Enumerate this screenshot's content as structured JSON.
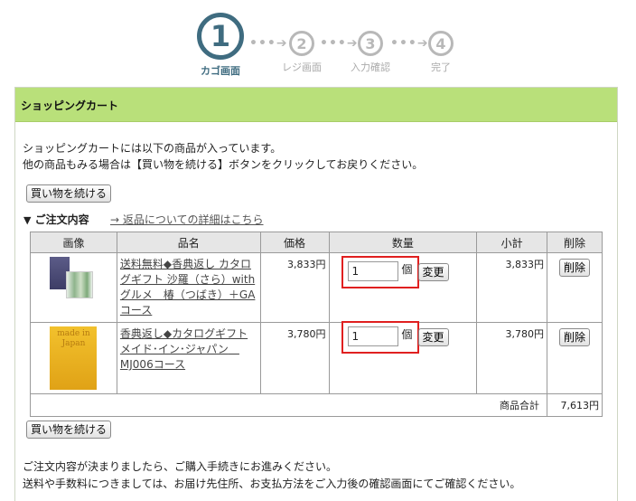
{
  "steps": [
    {
      "num": "1",
      "label": "カゴ画面"
    },
    {
      "num": "2",
      "label": "レジ画面"
    },
    {
      "num": "3",
      "label": "入力確認"
    },
    {
      "num": "4",
      "label": "完了"
    }
  ],
  "step_arrow": "•••➔",
  "panel": {
    "title": "ショッピングカート",
    "intro_line1": "ショッピングカートには以下の商品が入っています。",
    "intro_line2": "他の商品もみる場合は【買い物を続ける】ボタンをクリックしてお戻りください。",
    "continue_label": "買い物を続ける"
  },
  "order": {
    "heading_marker": "▼",
    "heading": "ご注文内容",
    "returns_link": "→ 返品についての詳細はこちら"
  },
  "table": {
    "headers": [
      "画像",
      "品名",
      "価格",
      "数量",
      "小計",
      "削除"
    ],
    "rows": [
      {
        "name": "送料無料◆香典返し カタログギフト 沙羅（さら）with グルメ　椿（つばき）＋GAコース",
        "price": "3,833円",
        "qty": "1",
        "unit": "個",
        "change_label": "変更",
        "subtotal": "3,833円",
        "delete_label": "削除"
      },
      {
        "name": "香典返し◆カタログギフト メイド･イン･ジャパン　MJ006コース",
        "price": "3,780円",
        "qty": "1",
        "unit": "個",
        "change_label": "変更",
        "subtotal": "3,780円",
        "delete_label": "削除"
      }
    ],
    "total_label": "商品合計",
    "total_value": "7,613円"
  },
  "thumb2_text": "made in Japan",
  "footer": {
    "line1": "ご注文内容が決まりましたら、ご購入手続きにお進みください。",
    "line2": "送料や手数料につきましては、お届け先住所、お支払方法をご入力後の確認画面にてご確認ください。"
  },
  "colors": {
    "header_green": "#b9e07a",
    "step_active": "#3f6c80",
    "step_inactive": "#b8b8b8",
    "qty_highlight": "#e02020"
  }
}
